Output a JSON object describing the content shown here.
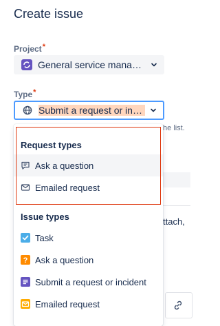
{
  "page": {
    "title": "Create issue"
  },
  "project": {
    "label": "Project",
    "required_mark": "*",
    "value": "General service managem...",
    "icon": "project-icon"
  },
  "type": {
    "label": "Type",
    "required_mark": "*",
    "value": "Submit a request or incide...",
    "icon": "globe-icon"
  },
  "background": {
    "helper_text": "he list.",
    "partial_text": "ttach,"
  },
  "dropdown": {
    "groups": [
      {
        "heading": "Request types",
        "items": [
          {
            "label": "Ask a question",
            "icon": "comment-icon",
            "hovered": true
          },
          {
            "label": "Emailed request",
            "icon": "envelope-icon",
            "hovered": false
          }
        ]
      },
      {
        "heading": "Issue types",
        "items": [
          {
            "label": "Task",
            "icon": "task-checkbox-icon",
            "color": "#4bade8"
          },
          {
            "label": "Ask a question",
            "icon": "question-icon",
            "color": "#ff8b00"
          },
          {
            "label": "Submit a request or incident",
            "icon": "request-icon",
            "color": "#6554c0"
          },
          {
            "label": "Emailed request",
            "icon": "envelope-icon",
            "color": "#ffab00"
          }
        ]
      }
    ]
  },
  "colors": {
    "focus_border": "#4c9aff",
    "highlight": "#ffd6bd",
    "annotation": "#de350b"
  }
}
